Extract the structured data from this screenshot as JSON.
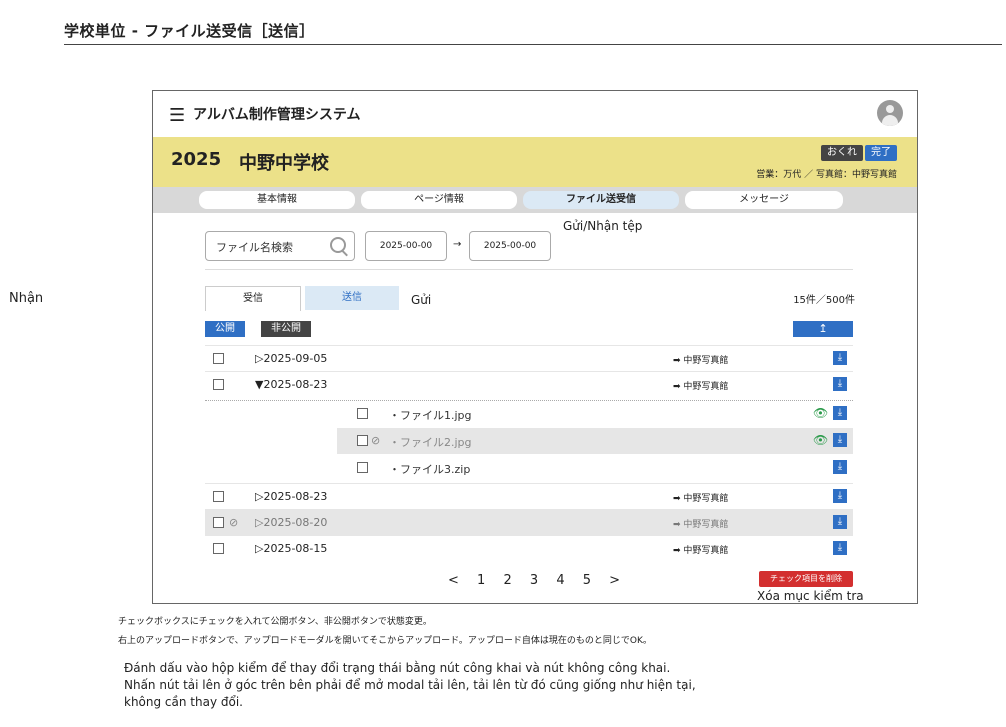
{
  "page": {
    "title": "学校単位 - ファイル送受信［送信］"
  },
  "app": {
    "menu_icon": "hamburger-icon",
    "name": "アルバム制作管理システム",
    "avatar_icon": "user-avatar-icon"
  },
  "school": {
    "year": "2025",
    "name": "中野中学校",
    "badge_late": "おくれ",
    "badge_done": "完了",
    "sales_info": "営業：万代 ／ 写真館：中野写真館",
    "colors": {
      "header_bg": "#ece189",
      "accent": "#2f6fc4",
      "danger": "#d32f2f"
    }
  },
  "tabs": [
    {
      "label": "基本情報"
    },
    {
      "label": "ページ情報"
    },
    {
      "label": "ファイル送受信",
      "active": true
    },
    {
      "label": "メッセージ"
    }
  ],
  "annotation_sendrecv": "Gửi/Nhận tệp",
  "search": {
    "placeholder": "ファイル名検索",
    "date_from": "2025-00-00",
    "arrow": "→",
    "date_to": "2025-00-00"
  },
  "mode": {
    "side_label": "Nhận",
    "recv": "受信",
    "send": "送信",
    "annotation": "Gửi",
    "count": "15件／500件"
  },
  "actions": {
    "public": "公開",
    "private": "非公開",
    "upload_icon": "↥"
  },
  "rows": [
    {
      "expander": "▷",
      "date": "2025-09-05",
      "dest": "➡ 中野写真館",
      "hidden": false
    },
    {
      "expander": "▼",
      "date": "2025-08-23",
      "dest": "➡ 中野写真館",
      "hidden": false
    },
    {
      "expander": "▷",
      "date": "2025-08-23",
      "dest": "➡ 中野写真館",
      "hidden": false
    },
    {
      "expander": "▷",
      "date": "2025-08-20",
      "dest": "➡ 中野写真館",
      "hidden": true
    },
    {
      "expander": "▷",
      "date": "2025-08-15",
      "dest": "➡ 中野写真館",
      "hidden": false
    }
  ],
  "files": [
    {
      "name": "・ファイル1.jpg",
      "preview": true,
      "hidden": false
    },
    {
      "name": "・ファイル2.jpg",
      "preview": true,
      "hidden": true
    },
    {
      "name": "・ファイル3.zip",
      "preview": false,
      "hidden": false
    }
  ],
  "pager": {
    "prev": "<",
    "pages": [
      "1",
      "2",
      "3",
      "4",
      "5"
    ],
    "next": ">"
  },
  "delete_button": "チェック項目を削除",
  "annotation_delete": "Xóa mục kiểm tra",
  "notes_jp": [
    "チェックボックスにチェックを入れて公開ボタン、非公開ボタンで状態変更。",
    "右上のアップロードボタンで、アップロードモーダルを開いてそこからアップロード。アップロード自体は現在のものと同じでOK。"
  ],
  "notes_vi": [
    "Đánh dấu vào hộp kiểm để thay đổi trạng thái bằng nút công khai và nút không công khai.",
    "Nhấn nút tải lên ở góc trên bên phải để mở modal tải lên, tải lên từ đó cũng giống như hiện tại,",
    "không cần thay đổi."
  ]
}
